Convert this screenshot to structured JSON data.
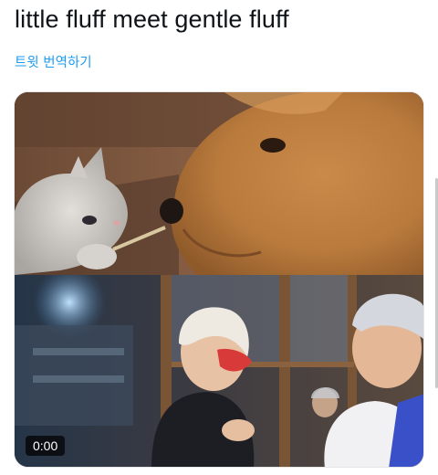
{
  "tweet": {
    "text": "little fluff meet gentle fluff",
    "translate_label": "트윗 번역하기"
  },
  "media": {
    "video_time": "0:00"
  },
  "colors": {
    "link": "#1d9bf0",
    "text": "#0f1419"
  }
}
